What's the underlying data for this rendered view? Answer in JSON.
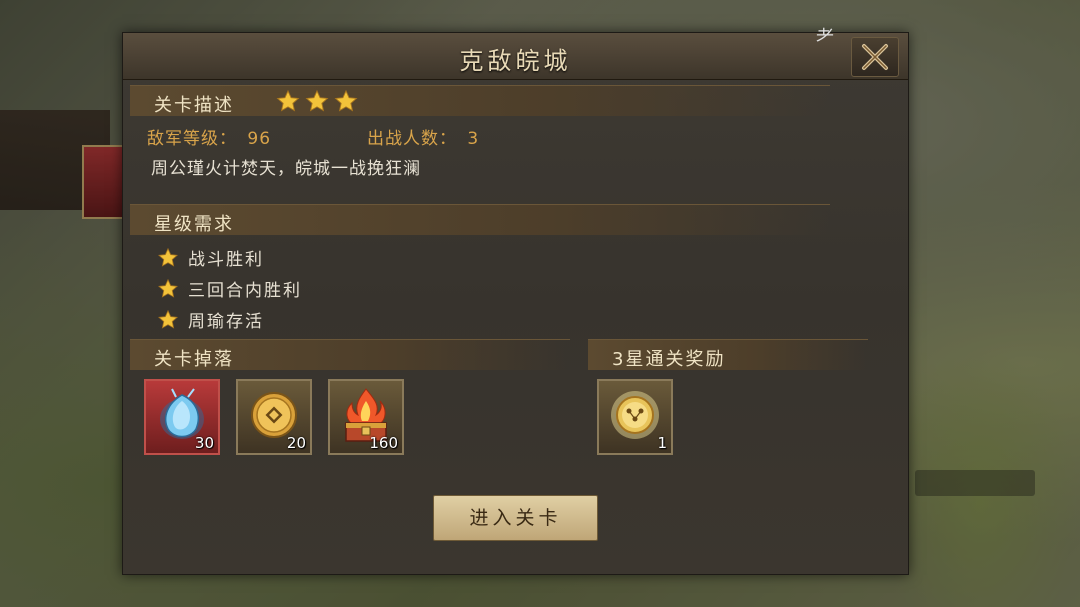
{
  "dialog": {
    "title": "克敌皖城",
    "close_icon": "close-x-icon"
  },
  "description_section": {
    "label": "关卡描述",
    "stars": 3,
    "enemy_level_label": "敌军等级：",
    "enemy_level_value": "96",
    "battle_count_label": "出战人数：",
    "battle_count_value": "3",
    "text": "周公瑾火计焚天，皖城一战挽狂澜"
  },
  "star_requirements": {
    "label": "星级需求",
    "items": [
      "战斗胜利",
      "三回合内胜利",
      "周瑜存活"
    ]
  },
  "drops": {
    "label": "关卡掉落",
    "items": [
      {
        "icon": "blue-crystal-icon",
        "count": "30"
      },
      {
        "icon": "gold-coin-icon",
        "count": "20"
      },
      {
        "icon": "fire-chest-icon",
        "count": "160"
      }
    ]
  },
  "reward": {
    "label": "3星通关奖励",
    "items": [
      {
        "icon": "gold-token-icon",
        "count": "1"
      }
    ]
  },
  "enter_button": "进入关卡",
  "colors": {
    "accent_gold": "#d9a44a",
    "star": "#f3c33a",
    "panel": "#3b362f"
  }
}
